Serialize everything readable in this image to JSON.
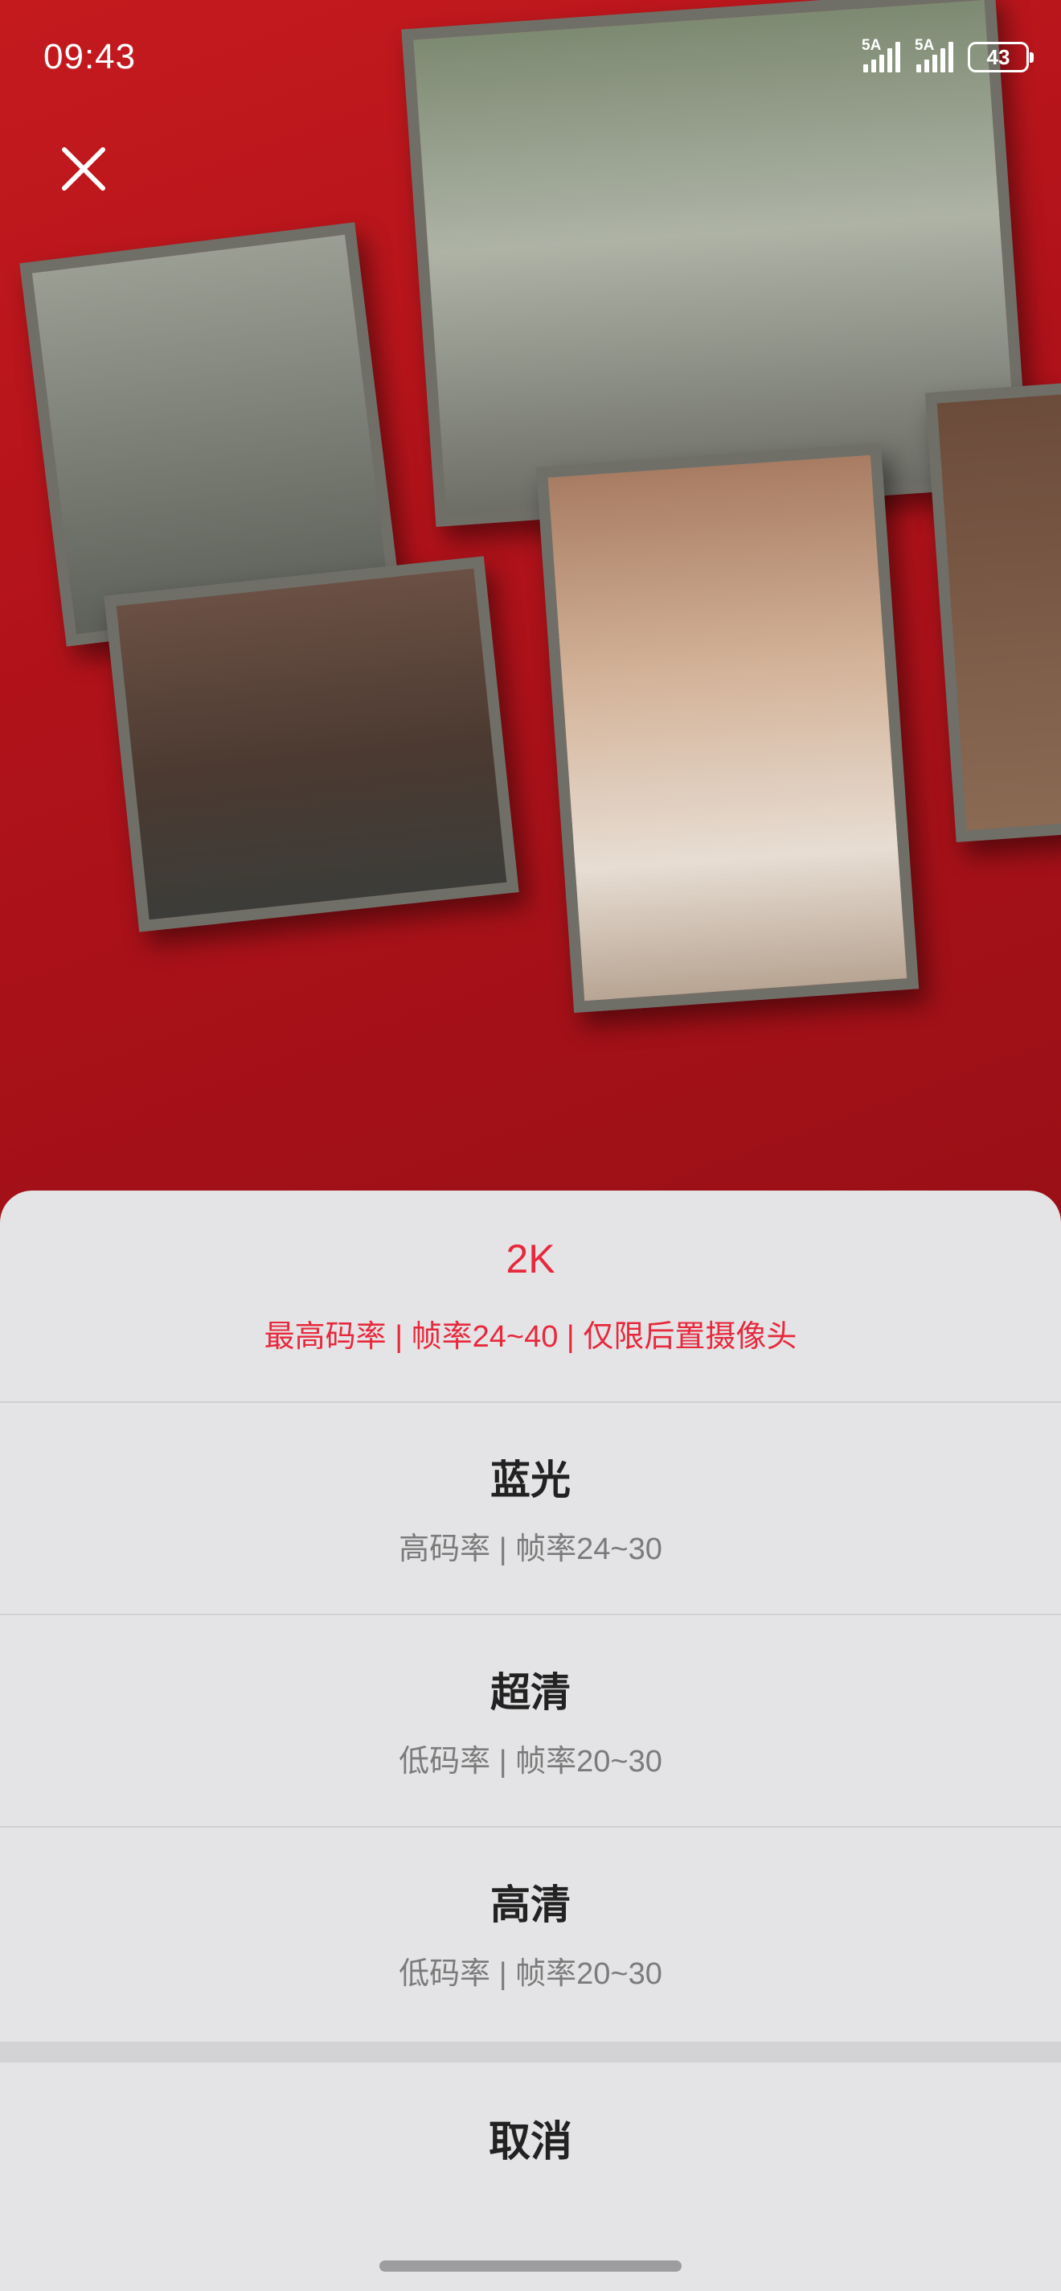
{
  "status_bar": {
    "time": "09:43",
    "signal_1_label": "5A",
    "signal_2_label": "5A",
    "battery_level": "43"
  },
  "close_icon": "close-icon",
  "quality_options": [
    {
      "title": "2K",
      "description": "最高码率 | 帧率24~40 | 仅限后置摄像头",
      "selected": true
    },
    {
      "title": "蓝光",
      "description": "高码率 | 帧率24~30",
      "selected": false
    },
    {
      "title": "超清",
      "description": "低码率 | 帧率20~30",
      "selected": false
    },
    {
      "title": "高清",
      "description": "低码率 | 帧率20~30",
      "selected": false
    }
  ],
  "cancel_label": "取消",
  "colors": {
    "selected": "#e8283c",
    "sheet_background": "#e4e4e6",
    "primary_text": "#222222",
    "secondary_text": "#7b7b7b"
  }
}
